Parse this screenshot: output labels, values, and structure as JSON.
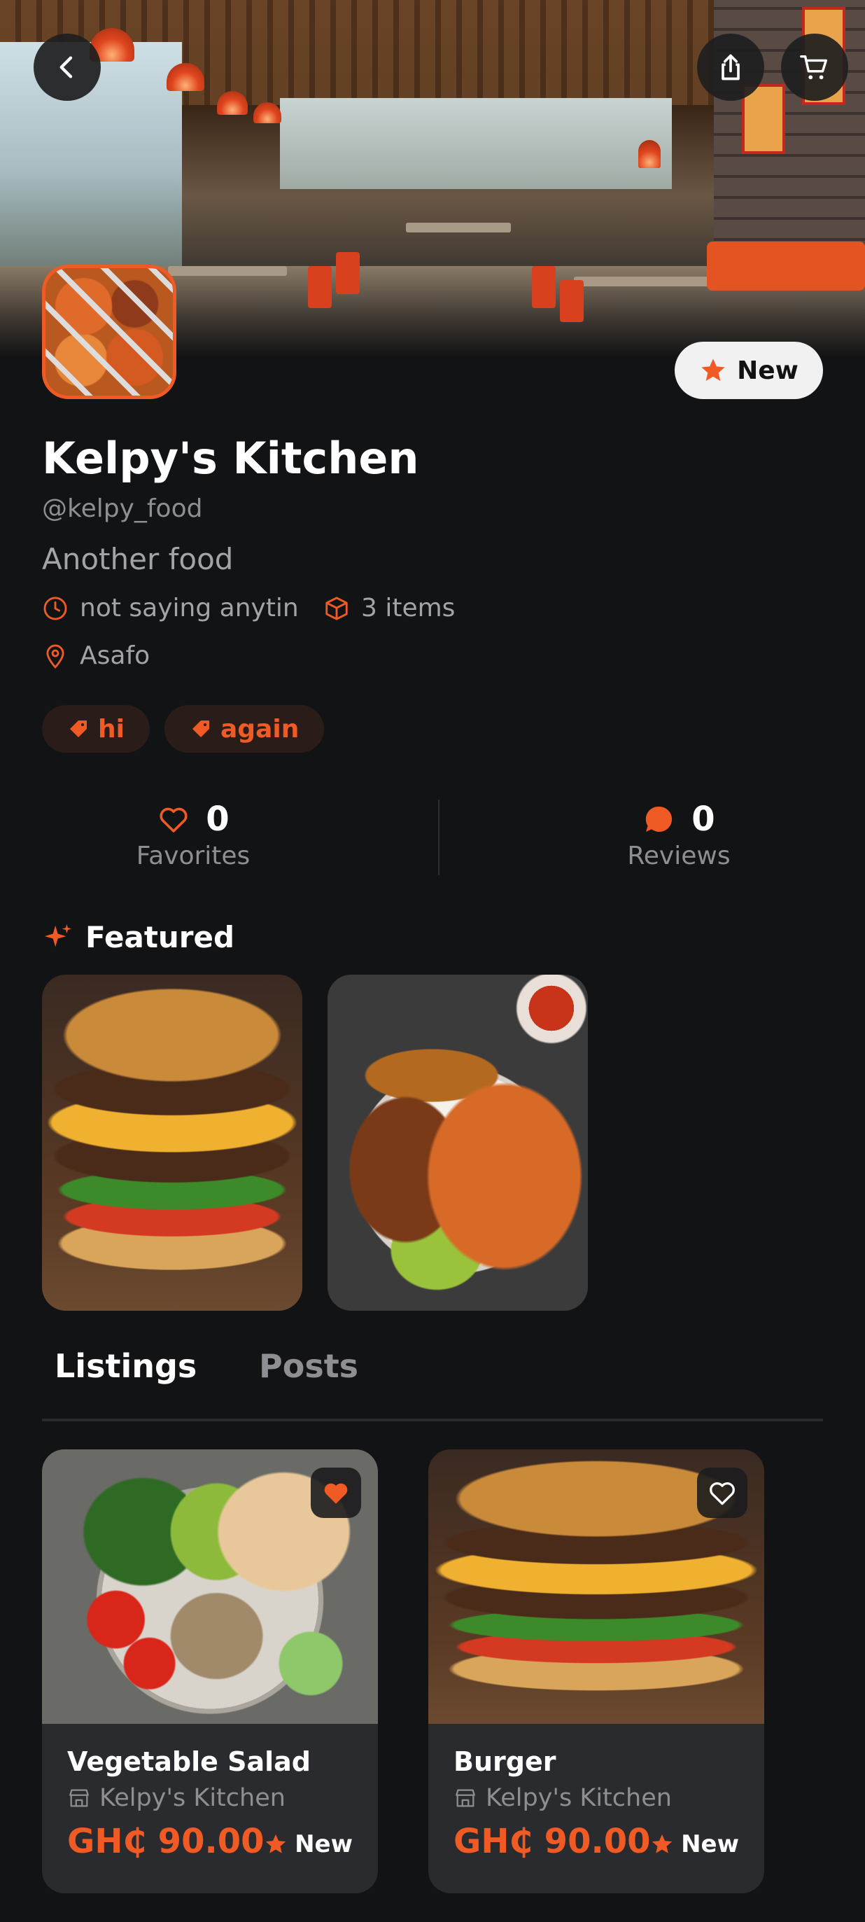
{
  "header": {
    "back_icon": "chevron-left-icon",
    "share_icon": "share-icon",
    "cart_icon": "cart-icon",
    "badge_label": "New"
  },
  "profile": {
    "name": "Kelpy's Kitchen",
    "handle": "@kelpy_food",
    "tagline": "Another food",
    "hours": "not saying anytin",
    "item_count": "3 items",
    "location": "Asafo",
    "tags": [
      "hi",
      "again"
    ]
  },
  "stats": {
    "favorites": {
      "value": "0",
      "label": "Favorites"
    },
    "reviews": {
      "value": "0",
      "label": "Reviews"
    }
  },
  "featured": {
    "title": "Featured",
    "items": [
      {
        "image": "burger"
      },
      {
        "image": "jollof-chicken-plate"
      }
    ]
  },
  "tabs": [
    {
      "label": "Listings",
      "active": true
    },
    {
      "label": "Posts",
      "active": false
    }
  ],
  "listings": [
    {
      "title": "Vegetable Salad",
      "store": "Kelpy's Kitchen",
      "price": "GH₵ 90.00",
      "badge": "New",
      "favorited": true
    },
    {
      "title": "Burger",
      "store": "Kelpy's Kitchen",
      "price": "GH₵ 90.00",
      "badge": "New",
      "favorited": false
    }
  ],
  "colors": {
    "accent": "#f05a24",
    "background": "#121315",
    "card": "#2a2b2e",
    "muted_text": "#8e8e93"
  }
}
